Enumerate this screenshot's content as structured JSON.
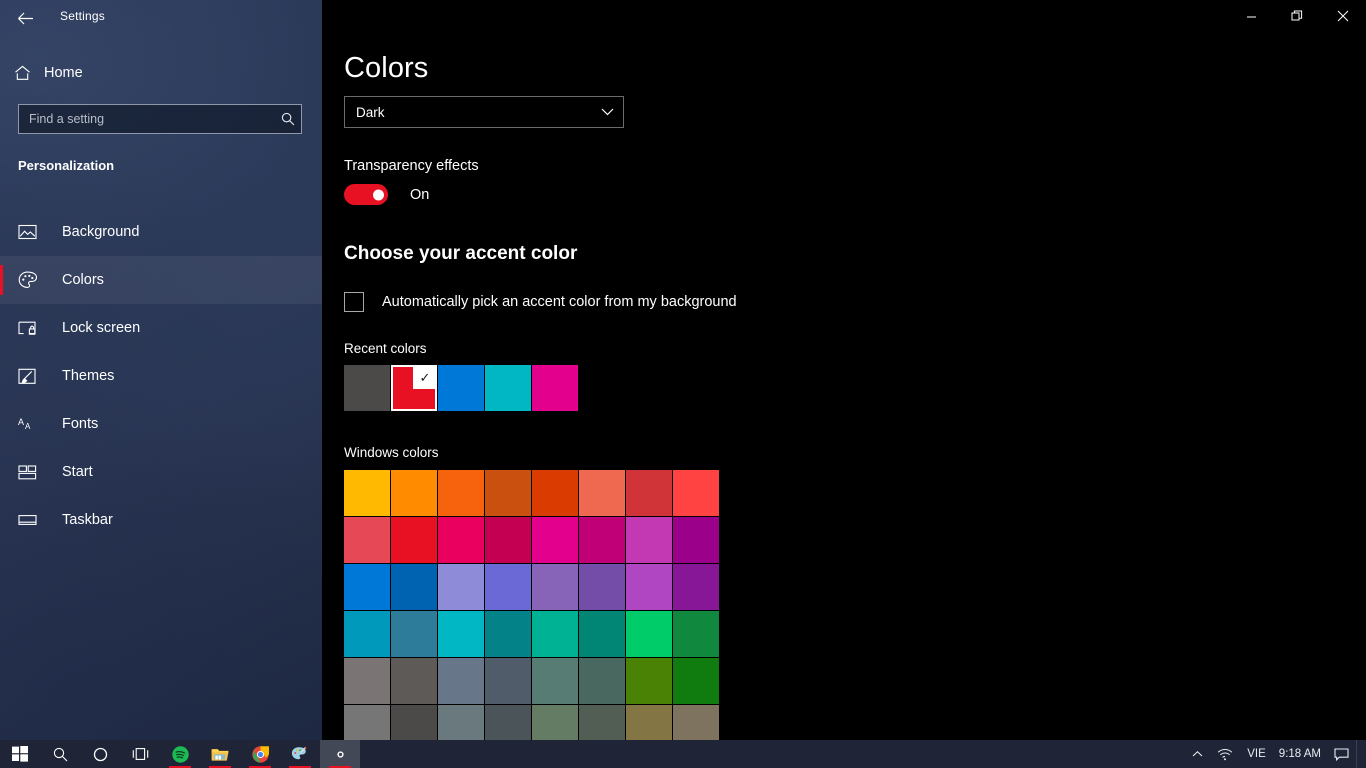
{
  "accent_color": "#e81123",
  "window": {
    "title": "Settings",
    "back_icon": "back-arrow-icon",
    "controls": [
      {
        "name": "minimize",
        "glyph": "─"
      },
      {
        "name": "restore",
        "glyph": "❐"
      },
      {
        "name": "close",
        "glyph": "✕"
      }
    ]
  },
  "sidebar": {
    "home_label": "Home",
    "home_icon": "home-icon",
    "search": {
      "placeholder": "Find a setting",
      "value": "",
      "icon": "search-icon"
    },
    "section_header": "Personalization",
    "items": [
      {
        "label": "Background",
        "icon": "image-icon",
        "selected": false
      },
      {
        "label": "Colors",
        "icon": "palette-icon",
        "selected": true
      },
      {
        "label": "Lock screen",
        "icon": "lockscreen-icon",
        "selected": false
      },
      {
        "label": "Themes",
        "icon": "brush-icon",
        "selected": false
      },
      {
        "label": "Fonts",
        "icon": "fonts-icon",
        "selected": false
      },
      {
        "label": "Start",
        "icon": "start-icon",
        "selected": false
      },
      {
        "label": "Taskbar",
        "icon": "taskbar-icon",
        "selected": false
      }
    ]
  },
  "main": {
    "page_title": "Colors",
    "color_mode": {
      "value": "Dark",
      "chevron": "⌄"
    },
    "transparency": {
      "label": "Transparency effects",
      "state": "On",
      "enabled": true
    },
    "accent_heading": "Choose your accent color",
    "auto_accent": {
      "label": "Automatically pick an accent color from my background",
      "checked": false
    },
    "recent_colors": {
      "label": "Recent colors",
      "check_glyph": "✓",
      "swatches": [
        {
          "color": "#4c4a48",
          "selected": false
        },
        {
          "color": "#e81123",
          "selected": true
        },
        {
          "color": "#0078d7",
          "selected": false
        },
        {
          "color": "#00b7c3",
          "selected": false
        },
        {
          "color": "#e3008c",
          "selected": false
        }
      ]
    },
    "windows_colors": {
      "label": "Windows colors",
      "swatches": [
        "#ffb900",
        "#ff8c00",
        "#f7630c",
        "#ca5010",
        "#da3b01",
        "#ef6950",
        "#d13438",
        "#ff4343",
        "#e74856",
        "#e81123",
        "#ea005e",
        "#c30052",
        "#e3008c",
        "#bf0077",
        "#c239b3",
        "#9a0089",
        "#0078d7",
        "#0063b1",
        "#8e8cd8",
        "#6b69d6",
        "#8764b8",
        "#744da9",
        "#b146c2",
        "#881798",
        "#0099bc",
        "#2d7d9a",
        "#00b7c3",
        "#038387",
        "#00b294",
        "#018574",
        "#00cc6a",
        "#10893e",
        "#7a7574",
        "#5d5a58",
        "#68768a",
        "#515c6b",
        "#567c73",
        "#486860",
        "#498205",
        "#107c10",
        "#767676",
        "#4c4a48",
        "#69797e",
        "#4a5459",
        "#647c64",
        "#525e54",
        "#847545",
        "#7e735f"
      ]
    }
  },
  "taskbar": {
    "left_buttons": [
      {
        "name": "start-button",
        "icon": "windows-logo-icon",
        "running": false,
        "active": false
      },
      {
        "name": "search-button",
        "icon": "search-icon",
        "running": false,
        "active": false
      },
      {
        "name": "cortana-button",
        "icon": "cortana-icon",
        "running": false,
        "active": false
      },
      {
        "name": "task-view-button",
        "icon": "task-view-icon",
        "running": false,
        "active": false
      },
      {
        "name": "spotify-button",
        "icon": "spotify-icon",
        "running": true,
        "active": false
      },
      {
        "name": "explorer-button",
        "icon": "file-explorer-icon",
        "running": true,
        "active": false
      },
      {
        "name": "chrome-button",
        "icon": "chrome-icon",
        "running": true,
        "active": false
      },
      {
        "name": "paint-button",
        "icon": "paint-icon",
        "running": true,
        "active": false
      },
      {
        "name": "settings-button",
        "icon": "gear-icon",
        "running": true,
        "active": true
      }
    ],
    "tray": {
      "overflow_glyph": "⌃",
      "network_icon": "wifi-icon",
      "language": "VIE",
      "time": "9:18 AM",
      "action_center_icon": "notification-icon"
    }
  }
}
